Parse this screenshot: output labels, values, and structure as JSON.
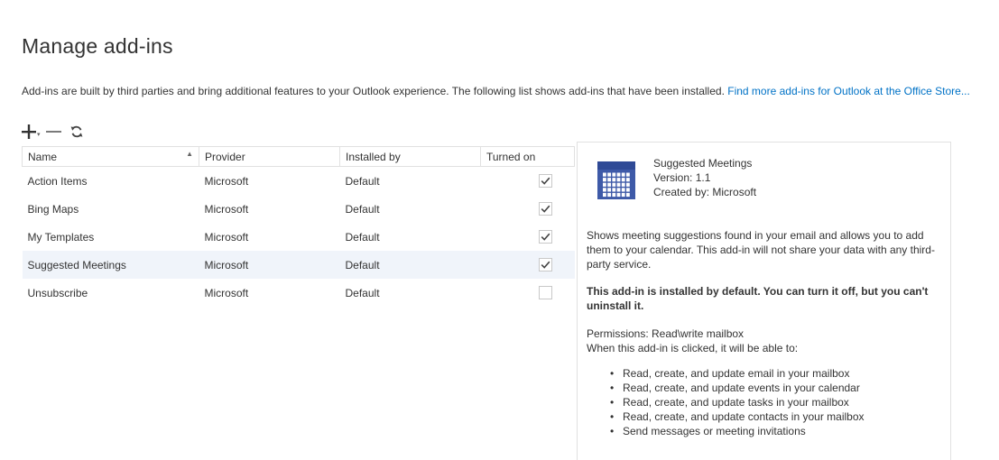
{
  "page": {
    "title": "Manage add-ins",
    "description": "Add-ins are built by third parties and bring additional features to your Outlook experience. The following list shows add-ins that have been installed.",
    "store_link": "Find more add-ins for Outlook at the Office Store..."
  },
  "toolbar": {
    "add": "plus-icon",
    "remove": "minus-icon",
    "refresh": "refresh-icon"
  },
  "table": {
    "columns": [
      "Name",
      "Provider",
      "Installed by",
      "Turned on"
    ],
    "rows": [
      {
        "name": "Action Items",
        "provider": "Microsoft",
        "installed_by": "Default",
        "turned_on": true
      },
      {
        "name": "Bing Maps",
        "provider": "Microsoft",
        "installed_by": "Default",
        "turned_on": true
      },
      {
        "name": "My Templates",
        "provider": "Microsoft",
        "installed_by": "Default",
        "turned_on": true
      },
      {
        "name": "Suggested Meetings",
        "provider": "Microsoft",
        "installed_by": "Default",
        "turned_on": true
      },
      {
        "name": "Unsubscribe",
        "provider": "Microsoft",
        "installed_by": "Default",
        "turned_on": false
      }
    ],
    "selected_row": "Suggested Meetings"
  },
  "detail": {
    "icon": "calendar-icon",
    "name": "Suggested Meetings",
    "version": "Version: 1.1",
    "created_by": "Created by: Microsoft",
    "description": "Shows meeting suggestions found in your email and allows you to add them to your calendar. This add-in will not share your data with any third-party service.",
    "note": "This add-in is installed by default. You can turn it off, but you can't uninstall it.",
    "permissions_label": "Permissions: Read\\write mailbox",
    "permissions_intro": "When this add-in is clicked, it will be able to:",
    "permissions": [
      "Read, create, and update email in your mailbox",
      "Read, create, and update events in your calendar",
      "Read, create, and update tasks in your mailbox",
      "Read, create, and update contacts in your mailbox",
      "Send messages or meeting invitations"
    ]
  },
  "colors": {
    "link": "#0072c6",
    "selected_row": "#f0f4fa",
    "icon_blue": "#3e5aa8"
  }
}
